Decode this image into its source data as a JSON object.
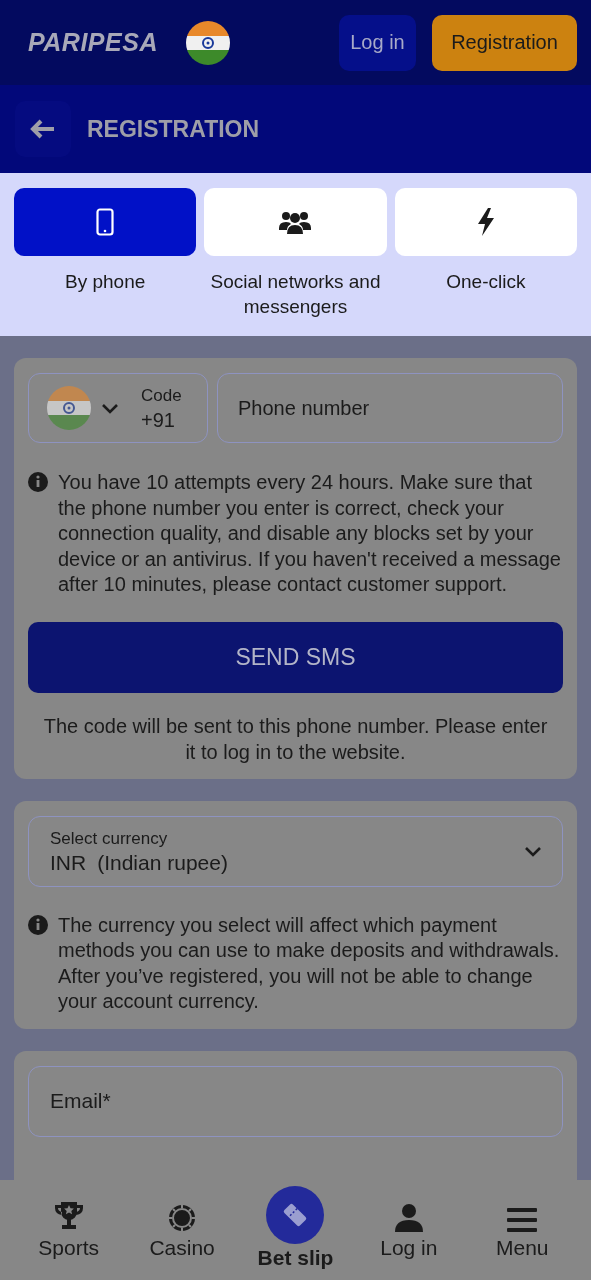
{
  "header": {
    "logo": "PARIPESA",
    "login_button": "Log in",
    "register_button": "Registration"
  },
  "page_title": "REGISTRATION",
  "methods": [
    {
      "kind": "phone",
      "label": "By phone",
      "selected": true
    },
    {
      "kind": "social",
      "label": "Social networks and messengers",
      "selected": false
    },
    {
      "kind": "oneclick",
      "label": "One-click",
      "selected": false
    }
  ],
  "phone_card": {
    "code_label": "Code",
    "code_value": "+91",
    "phone_placeholder": "Phone number",
    "note": "You have 10 attempts every 24 hours. Make sure that the phone number you enter is correct, check your connection quality, and disable any blocks set by your device or an antivirus. If you haven't received a message after 10 minutes, please contact customer support.",
    "send_button": "SEND SMS",
    "hint": "The code will be sent to this phone number. Please enter it to log in to the website."
  },
  "currency_card": {
    "label": "Select currency",
    "code": "INR",
    "name": "(Indian rupee)",
    "note": "The currency you select will affect which payment methods you can use to make deposits and withdrawals. After you’ve registered, you will not be able to change your account currency."
  },
  "email_card": {
    "placeholder": "Email*"
  },
  "bottom_nav": [
    {
      "kind": "sports",
      "label": "Sports"
    },
    {
      "kind": "casino",
      "label": "Casino"
    },
    {
      "kind": "betslip",
      "label": "Bet slip"
    },
    {
      "kind": "login",
      "label": "Log in"
    },
    {
      "kind": "menu",
      "label": "Menu"
    }
  ]
}
